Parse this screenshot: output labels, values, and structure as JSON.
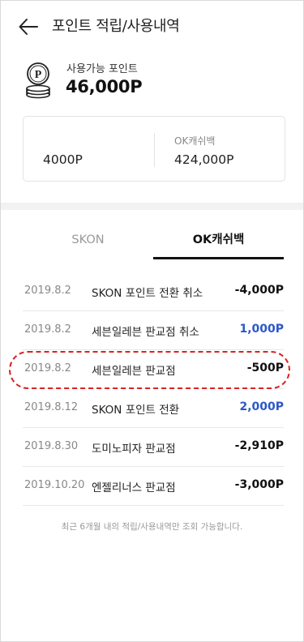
{
  "header": {
    "title": "포인트 적립/사용내역"
  },
  "summary": {
    "label": "사용가능 포인트",
    "value": "46,000P"
  },
  "breakdown": {
    "left": {
      "label": "",
      "value": "4000P"
    },
    "right": {
      "label": "OK캐쉬백",
      "value": "424,000P"
    }
  },
  "tabs": [
    {
      "label": "SKON",
      "active": false
    },
    {
      "label": "OK캐쉬백",
      "active": true
    }
  ],
  "transactions": [
    {
      "date": "2019.8.2",
      "desc": "SKON 포인트 전환 취소",
      "amount": "-4,000P",
      "type": "minus"
    },
    {
      "date": "2019.8.2",
      "desc": "세븐일레븐 판교점 취소",
      "amount": "1,000P",
      "type": "plus"
    },
    {
      "date": "2019.8.2",
      "desc": "세븐일레븐 판교점",
      "amount": "-500P",
      "type": "minus",
      "highlighted": true
    },
    {
      "date": "2019.8.12",
      "desc": "SKON 포인트 전환",
      "amount": "2,000P",
      "type": "plus"
    },
    {
      "date": "2019.8.30",
      "desc": "도미노피자 판교점",
      "amount": "-2,910P",
      "type": "minus"
    },
    {
      "date": "2019.10.20",
      "desc": "엔젤리너스 판교점",
      "amount": "-3,000P",
      "type": "minus"
    }
  ],
  "notice": "최근 6개월 내의 적립/사용내역만 조회 가능합니다.",
  "colors": {
    "plus": "#2b58c8",
    "minus": "#111111",
    "highlight": "#d82424"
  },
  "icons": {
    "back": "arrow-left-icon",
    "coin": "coin-stack-icon"
  }
}
